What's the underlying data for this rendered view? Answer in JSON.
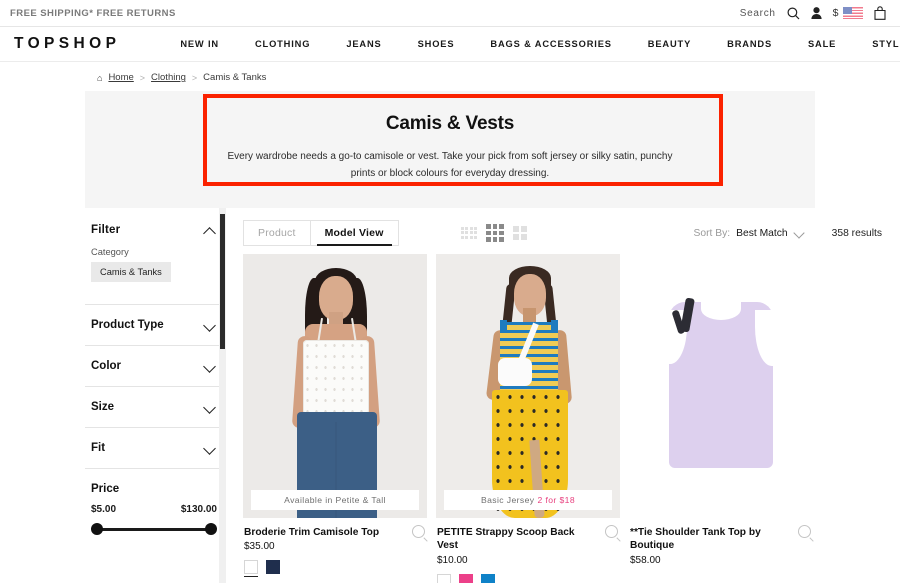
{
  "utility_bar": {
    "shipping_message": "FREE SHIPPING* FREE RETURNS",
    "search_label": "Search",
    "search_icon": "search-icon",
    "account_icon": "user-icon",
    "currency_symbol": "$",
    "flag_icon": "us-flag-icon",
    "bag_icon": "shopping-bag-icon"
  },
  "header": {
    "logo": "TOPSHOP",
    "nav_items": [
      {
        "label": "NEW IN"
      },
      {
        "label": "CLOTHING"
      },
      {
        "label": "JEANS"
      },
      {
        "label": "SHOES"
      },
      {
        "label": "BAGS & ACCESSORIES"
      },
      {
        "label": "BEAUTY"
      },
      {
        "label": "BRANDS"
      },
      {
        "label": "SALE"
      },
      {
        "label": "STYLE"
      }
    ]
  },
  "breadcrumb": {
    "home_icon": "home-icon",
    "items": [
      {
        "label": "Home",
        "link": true
      },
      {
        "label": "Clothing",
        "link": true
      },
      {
        "label": "Camis & Tanks",
        "link": false
      }
    ],
    "separator": ">"
  },
  "hero": {
    "title": "Camis & Vests",
    "description": "Every wardrobe needs a go-to camisole or vest. Take your pick from soft jersey or silky satin, punchy prints or block colours for everyday dressing.",
    "highlight_color": "#fb2200",
    "background_color": "#f5f5f5"
  },
  "sidebar": {
    "filter_title": "Filter",
    "filter_chevron": "chevron-up-icon",
    "category_label": "Category",
    "selected_category": "Camis & Tanks",
    "groups": [
      {
        "label": "Product Type",
        "icon": "chevron-down-icon"
      },
      {
        "label": "Color",
        "icon": "chevron-down-icon"
      },
      {
        "label": "Size",
        "icon": "chevron-down-icon"
      },
      {
        "label": "Fit",
        "icon": "chevron-down-icon"
      }
    ],
    "price": {
      "title": "Price",
      "min": "$5.00",
      "max": "$130.00"
    }
  },
  "toolbar": {
    "view_tabs": [
      {
        "label": "Product",
        "active": false
      },
      {
        "label": "Model View",
        "active": true
      }
    ],
    "grid_icons": [
      {
        "name": "grid-small-icon",
        "active": false
      },
      {
        "name": "grid-medium-icon",
        "active": true
      },
      {
        "name": "grid-large-icon",
        "active": false
      }
    ],
    "sort_label": "Sort By:",
    "sort_value": "Best Match",
    "sort_icon": "chevron-down-icon",
    "results_count": "358 results"
  },
  "products": [
    {
      "name": "Broderie Trim Camisole Top",
      "price": "$35.00",
      "badge": "Available in Petite & Tall",
      "badge_highlight": "",
      "quickview_icon": "magnifier-icon",
      "swatches": [
        {
          "name": "white",
          "color": "#ffffff",
          "selected": true
        },
        {
          "name": "navy",
          "color": "#1f2e4d",
          "selected": false
        }
      ]
    },
    {
      "name": "PETITE Strappy Scoop Back Vest",
      "price": "$10.00",
      "badge": "Basic Jersey",
      "badge_highlight": "2 for $18",
      "quickview_icon": "magnifier-icon",
      "swatches": [
        {
          "name": "white",
          "color": "#ffffff",
          "selected": false
        },
        {
          "name": "pink",
          "color": "#ec4089",
          "selected": false
        },
        {
          "name": "blue",
          "color": "#0f82c8",
          "selected": false
        }
      ]
    },
    {
      "name": "**Tie Shoulder Tank Top by Boutique",
      "price": "$58.00",
      "badge": "",
      "badge_highlight": "",
      "quickview_icon": "magnifier-icon",
      "swatches": []
    }
  ]
}
